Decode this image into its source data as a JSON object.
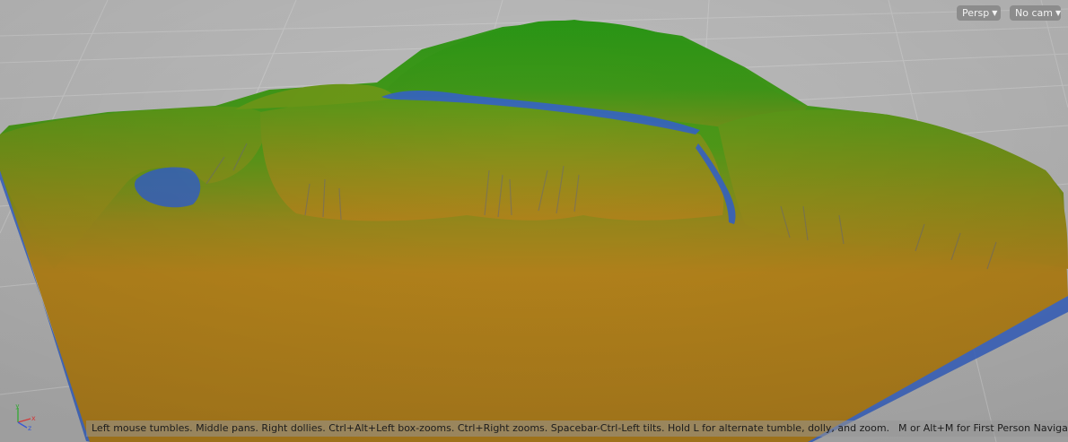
{
  "viewport": {
    "projection_menu": {
      "label": "Persp",
      "icon": "chevron-down-icon"
    },
    "camera_menu": {
      "label": "No cam",
      "icon": "chevron-down-icon"
    },
    "status_hint": {
      "main": "Left mouse tumbles. Middle pans. Right dollies. Ctrl+Alt+Left box-zooms. Ctrl+Right zooms. Spacebar-Ctrl-Left tilts. Hold L for alternate tumble, dolly, and zoom.",
      "extra": "M or Alt+M for First Person Navigation."
    },
    "axis_gizmo": {
      "x_label": "x",
      "y_label": "y",
      "z_label": "z"
    },
    "colors": {
      "background": "#b9b9b9",
      "grid_line": "#cfcfcf",
      "terrain_low": "#b8861c",
      "terrain_high": "#2f9a1a",
      "water": "#3563c8"
    }
  }
}
